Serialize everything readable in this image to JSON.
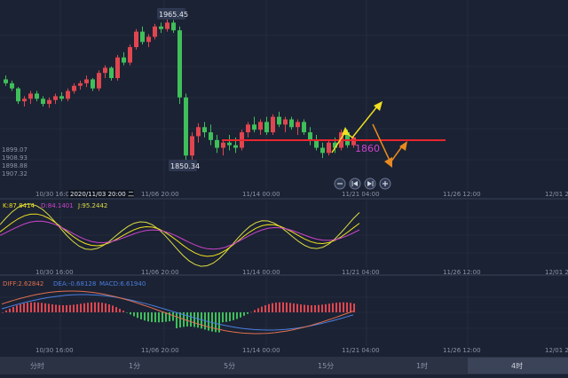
{
  "colors": {
    "bg": "#1b2233",
    "grid": "#2b3448",
    "up": "#e0464f",
    "down": "#3fbf5a",
    "text": "#8a93a6",
    "support": "#e8262f",
    "magenta": "#cc44cc",
    "yellow": "#f0e020",
    "orange": "#e88a20",
    "k": "#f0e020",
    "d": "#cc44cc",
    "j": "#dddd44",
    "dif": "#e07050",
    "dea": "#4a7fe0"
  },
  "main": {
    "high_label": "1965.45",
    "low_label": "1850.34",
    "support_label": "1860",
    "left_values": [
      "1899.07",
      "1908.93",
      "1898.88",
      "1907.32"
    ],
    "date_highlight": "2020/11/03 20:00 二",
    "x_ticks": [
      "10/30 16:00",
      "11/06 20:00",
      "11/14 00:00",
      "11/21 04:00",
      "11/26 12:00",
      "12/01 20:"
    ],
    "nav_buttons": [
      "minus",
      "rewind",
      "forward",
      "plus"
    ]
  },
  "kdj": {
    "k": "K:87.8414",
    "d": "D:84.1401",
    "j": "J:95.2442",
    "x_ticks": [
      "10/30 16:00",
      "11/06 20:00",
      "11/14 00:00",
      "11/21 04:00",
      "11/26 12:00",
      "12/01 20:"
    ]
  },
  "macd": {
    "dif": "DIFF:2.62842",
    "dea": "DEA:-0.68128",
    "macd": "MACD:6.61940",
    "x_ticks": [
      "10/30 16:00",
      "11/06 20:00",
      "11/14 00:00",
      "11/21 04:00",
      "11/26 12:00",
      "12/01 20:"
    ]
  },
  "timeframes": [
    "分时",
    "1分",
    "5分",
    "15分",
    "1时",
    "4时"
  ],
  "active_timeframe": "4时",
  "chart_data": {
    "type": "candlestick",
    "x_start": "10/30 16:00",
    "interval": "4h",
    "price_axis_range": [
      1843,
      1975
    ],
    "candles": [
      [
        1919,
        1922,
        1914,
        1916
      ],
      [
        1916,
        1918,
        1910,
        1912
      ],
      [
        1912,
        1913,
        1900,
        1902
      ],
      [
        1902,
        1906,
        1898,
        1904
      ],
      [
        1904,
        1910,
        1900,
        1908
      ],
      [
        1908,
        1910,
        1902,
        1904
      ],
      [
        1904,
        1906,
        1898,
        1900
      ],
      [
        1900,
        1905,
        1897,
        1903
      ],
      [
        1903,
        1908,
        1900,
        1906
      ],
      [
        1906,
        1909,
        1902,
        1904
      ],
      [
        1904,
        1912,
        1902,
        1910
      ],
      [
        1910,
        1916,
        1908,
        1914
      ],
      [
        1914,
        1918,
        1911,
        1916
      ],
      [
        1916,
        1922,
        1913,
        1919
      ],
      [
        1919,
        1920,
        1910,
        1912
      ],
      [
        1912,
        1926,
        1910,
        1924
      ],
      [
        1924,
        1930,
        1920,
        1928
      ],
      [
        1928,
        1929,
        1918,
        1920
      ],
      [
        1920,
        1938,
        1918,
        1936
      ],
      [
        1936,
        1940,
        1930,
        1932
      ],
      [
        1932,
        1946,
        1930,
        1944
      ],
      [
        1944,
        1958,
        1942,
        1956
      ],
      [
        1956,
        1960,
        1946,
        1948
      ],
      [
        1948,
        1954,
        1944,
        1952
      ],
      [
        1952,
        1962,
        1950,
        1960
      ],
      [
        1960,
        1963,
        1955,
        1958
      ],
      [
        1958,
        1966,
        1956,
        1963
      ],
      [
        1963,
        1965,
        1955,
        1957
      ],
      [
        1957,
        1960,
        1900,
        1905
      ],
      [
        1905,
        1908,
        1850,
        1860
      ],
      [
        1860,
        1878,
        1855,
        1875
      ],
      [
        1875,
        1885,
        1870,
        1882
      ],
      [
        1882,
        1886,
        1874,
        1878
      ],
      [
        1878,
        1884,
        1868,
        1872
      ],
      [
        1872,
        1876,
        1862,
        1866
      ],
      [
        1866,
        1872,
        1860,
        1870
      ],
      [
        1870,
        1876,
        1864,
        1868
      ],
      [
        1868,
        1874,
        1862,
        1866
      ],
      [
        1866,
        1880,
        1864,
        1878
      ],
      [
        1878,
        1886,
        1874,
        1884
      ],
      [
        1884,
        1890,
        1878,
        1880
      ],
      [
        1880,
        1888,
        1876,
        1886
      ],
      [
        1886,
        1890,
        1876,
        1878
      ],
      [
        1878,
        1892,
        1876,
        1890
      ],
      [
        1890,
        1894,
        1882,
        1884
      ],
      [
        1884,
        1890,
        1878,
        1888
      ],
      [
        1888,
        1890,
        1880,
        1882
      ],
      [
        1882,
        1888,
        1876,
        1886
      ],
      [
        1886,
        1888,
        1876,
        1878
      ],
      [
        1878,
        1882,
        1868,
        1872
      ],
      [
        1872,
        1876,
        1864,
        1866
      ],
      [
        1866,
        1870,
        1858,
        1862
      ],
      [
        1862,
        1872,
        1860,
        1870
      ],
      [
        1870,
        1874,
        1862,
        1866
      ],
      [
        1866,
        1880,
        1864,
        1878
      ],
      [
        1878,
        1880,
        1866,
        1868
      ],
      [
        1868,
        1876,
        1866,
        1874
      ]
    ],
    "support_level": 1860,
    "kdj": {
      "k": 87.8414,
      "d": 84.1401,
      "j": 95.2442
    },
    "macd": {
      "dif": 2.62842,
      "dea": -0.68128,
      "macd": 6.6194
    }
  }
}
